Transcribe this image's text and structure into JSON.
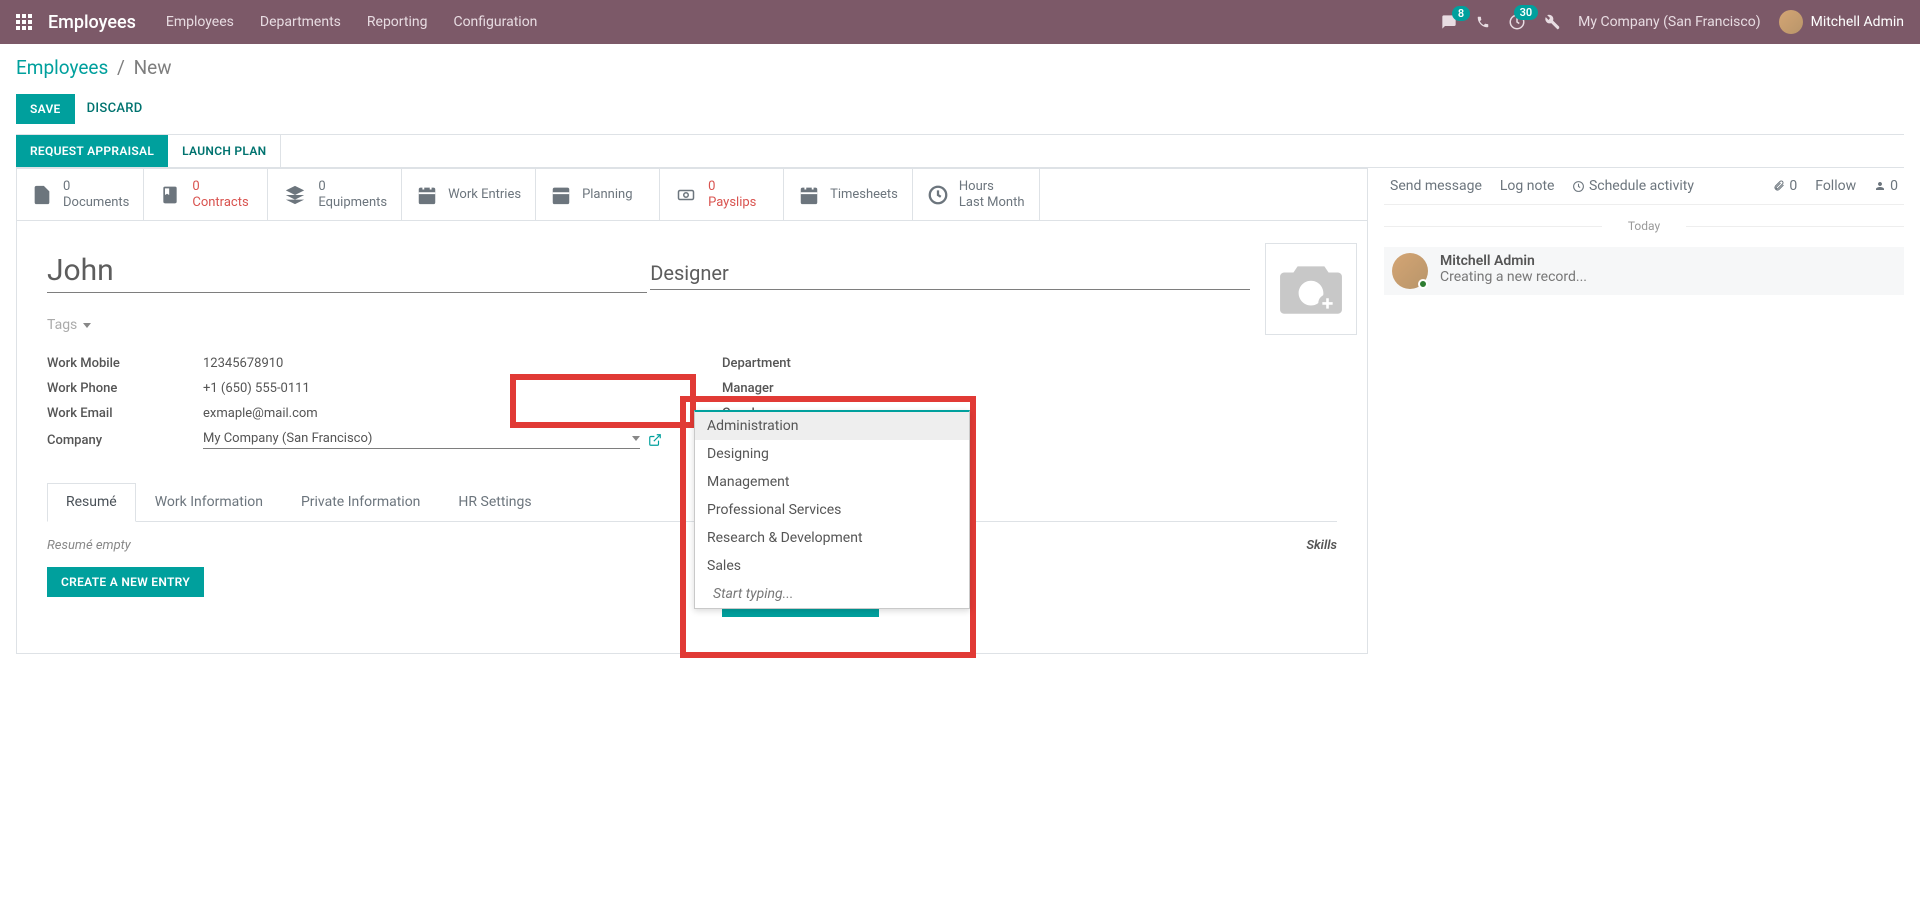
{
  "topnav": {
    "brand": "Employees",
    "menu": [
      "Employees",
      "Departments",
      "Reporting",
      "Configuration"
    ],
    "chat_badge": "8",
    "activity_badge": "30",
    "company": "My Company (San Francisco)",
    "user": "Mitchell Admin"
  },
  "breadcrumb": {
    "root": "Employees",
    "current": "New"
  },
  "actions": {
    "save": "SAVE",
    "discard": "DISCARD"
  },
  "status_buttons": {
    "request_appraisal": "REQUEST APPRAISAL",
    "launch_plan": "LAUNCH PLAN"
  },
  "stat_buttons": [
    {
      "id": "documents",
      "count": "0",
      "label": "Documents",
      "red": false
    },
    {
      "id": "contracts",
      "count": "0",
      "label": "Contracts",
      "red": true
    },
    {
      "id": "equipments",
      "count": "0",
      "label": "Equipments",
      "red": false
    },
    {
      "id": "work-entries",
      "count": "",
      "label": "Work Entries",
      "red": false
    },
    {
      "id": "planning",
      "count": "",
      "label": "Planning",
      "red": false
    },
    {
      "id": "payslips",
      "count": "0",
      "label": "Payslips",
      "red": true
    },
    {
      "id": "timesheets",
      "count": "",
      "label": "Timesheets",
      "red": false
    },
    {
      "id": "hours",
      "count": "Hours",
      "label": "Last Month",
      "red": false
    }
  ],
  "form": {
    "name": "John",
    "job_title": "Designer",
    "tags_placeholder": "Tags",
    "left_fields": {
      "work_mobile_label": "Work Mobile",
      "work_mobile": "12345678910",
      "work_phone_label": "Work Phone",
      "work_phone": "+1 (650) 555-0111",
      "work_email_label": "Work Email",
      "work_email": "exmaple@mail.com",
      "company_label": "Company",
      "company": "My Company (San Francisco)"
    },
    "right_fields": {
      "department_label": "Department",
      "manager_label": "Manager",
      "coach_label": "Coach"
    }
  },
  "dropdown": {
    "options": [
      "Administration",
      "Designing",
      "Management",
      "Professional Services",
      "Research & Development",
      "Sales"
    ],
    "typing": "Start typing..."
  },
  "tabs": [
    "Resumé",
    "Work Information",
    "Private Information",
    "HR Settings"
  ],
  "tab_content": {
    "resume_empty": "Resumé empty",
    "skills_label": "Skills",
    "create_entry": "CREATE A NEW ENTRY"
  },
  "chatter": {
    "send_message": "Send message",
    "log_note": "Log note",
    "schedule": "Schedule activity",
    "attach_count": "0",
    "follow": "Follow",
    "followers_count": "0",
    "today": "Today",
    "msg_author": "Mitchell Admin",
    "msg_text": "Creating a new record..."
  }
}
